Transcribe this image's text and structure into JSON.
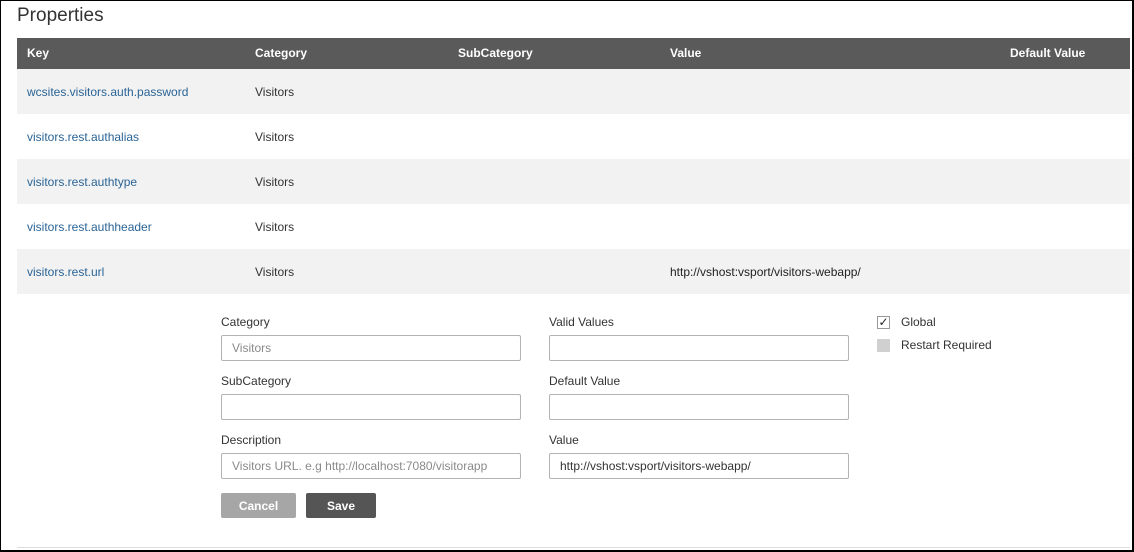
{
  "page": {
    "title": "Properties"
  },
  "table": {
    "headers": {
      "key": "Key",
      "category": "Category",
      "subcategory": "SubCategory",
      "value": "Value",
      "default_value": "Default Value"
    },
    "rows": [
      {
        "key": "wcsites.visitors.auth.password",
        "category": "Visitors",
        "subcategory": "",
        "value": "",
        "default_value": ""
      },
      {
        "key": "visitors.rest.authalias",
        "category": "Visitors",
        "subcategory": "",
        "value": "",
        "default_value": ""
      },
      {
        "key": "visitors.rest.authtype",
        "category": "Visitors",
        "subcategory": "",
        "value": "",
        "default_value": ""
      },
      {
        "key": "visitors.rest.authheader",
        "category": "Visitors",
        "subcategory": "",
        "value": "",
        "default_value": ""
      },
      {
        "key": "visitors.rest.url",
        "category": "Visitors",
        "subcategory": "",
        "value": "http://vshost:vsport/visitors-webapp/",
        "default_value": ""
      }
    ]
  },
  "editor": {
    "category_label": "Category",
    "category_placeholder": "Visitors",
    "category_value": "",
    "subcategory_label": "SubCategory",
    "subcategory_value": "",
    "description_label": "Description",
    "description_placeholder": "Visitors URL. e.g http://localhost:7080/visitorapp",
    "valid_values_label": "Valid Values",
    "valid_values_value": "",
    "default_value_label": "Default Value",
    "default_value_value": "",
    "value_label": "Value",
    "value_value": "http://vshost:vsport/visitors-webapp/",
    "global_label": "Global",
    "global_checked": true,
    "restart_label": "Restart Required",
    "restart_checked": false,
    "cancel_label": "Cancel",
    "save_label": "Save"
  },
  "colors": {
    "header_bg": "#5a5a5a",
    "link": "#2a6496",
    "cancel_bg": "#a6a6a6",
    "save_bg": "#555555"
  }
}
